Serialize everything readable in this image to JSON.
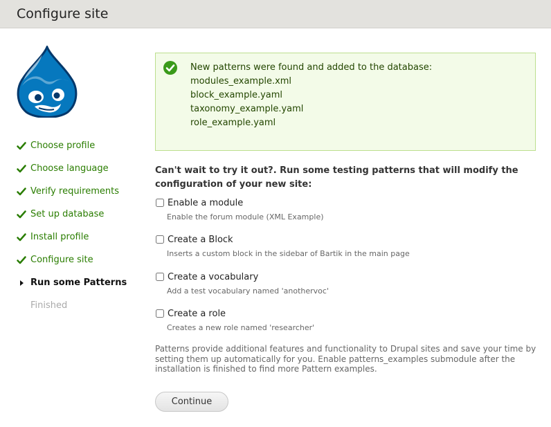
{
  "header": {
    "title": "Configure site"
  },
  "logo": {
    "name": "drupal-logo"
  },
  "steps": [
    {
      "label": "Choose profile",
      "state": "done"
    },
    {
      "label": "Choose language",
      "state": "done"
    },
    {
      "label": "Verify requirements",
      "state": "done"
    },
    {
      "label": "Set up database",
      "state": "done"
    },
    {
      "label": "Install profile",
      "state": "done"
    },
    {
      "label": "Configure site",
      "state": "done"
    },
    {
      "label": "Run some Patterns",
      "state": "active"
    },
    {
      "label": "Finished",
      "state": "todo"
    }
  ],
  "message": {
    "title": "New patterns were found and added to the database:",
    "files": [
      "modules_example.xml",
      "block_example.yaml",
      "taxonomy_example.yaml",
      "role_example.yaml"
    ]
  },
  "intro": "Can't wait to try it out?. Run some testing patterns that will modify the configuration of your new site:",
  "options": [
    {
      "label": "Enable a module",
      "description": "Enable the forum module (XML Example)",
      "checked": false
    },
    {
      "label": "Create a Block",
      "description": "Inserts a custom block in the sidebar of Bartik in the main page",
      "checked": false
    },
    {
      "label": "Create a vocabulary",
      "description": "Add a test vocabulary named 'anothervoc'",
      "checked": false
    },
    {
      "label": "Create a role",
      "description": "Creates a new role named 'researcher'",
      "checked": false
    }
  ],
  "note": "Patterns provide additional features and functionality to Drupal sites and save your time by setting them up automatically for you. Enable patterns_examples submodule after the installation is finished to find more Pattern examples.",
  "button": {
    "label": "Continue"
  },
  "colors": {
    "done": "#2a7d00",
    "header_bg": "#e3e2de",
    "message_bg": "#f3fbe8",
    "message_border": "#bcdf8e",
    "logo_blue": "#0678be"
  }
}
